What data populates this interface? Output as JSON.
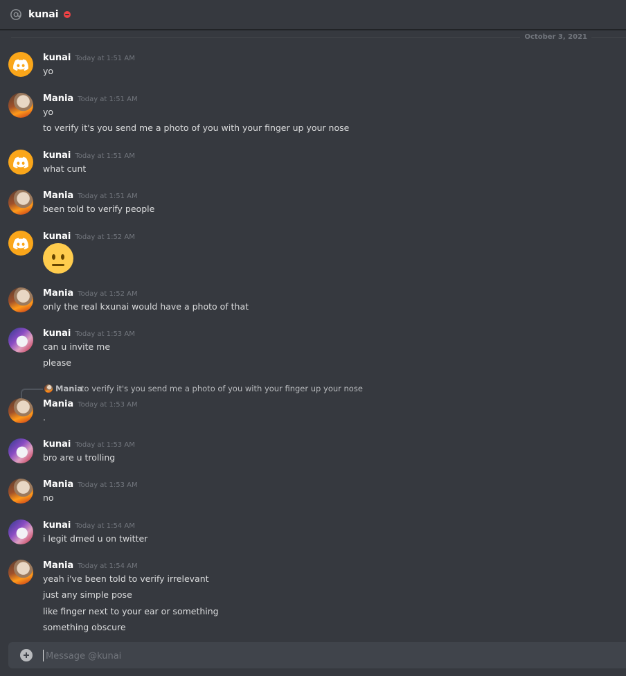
{
  "header": {
    "channel_name": "kunai",
    "status": "do-not-disturb",
    "status_color": "#ed4245",
    "icon": "at-icon"
  },
  "divider": {
    "date": "October 3, 2021"
  },
  "messages": [
    {
      "author": "kunai",
      "timestamp": "Today at 1:51 AM",
      "avatar": "discord-default-icon",
      "lines": [
        "yo"
      ]
    },
    {
      "author": "Mania",
      "timestamp": "Today at 1:51 AM",
      "avatar": "anime-avatar",
      "lines": [
        "yo",
        "to verify it's you send me a photo of you with your finger up your nose"
      ]
    },
    {
      "author": "kunai",
      "timestamp": "Today at 1:51 AM",
      "avatar": "discord-default-icon",
      "lines": [
        "what cunt"
      ]
    },
    {
      "author": "Mania",
      "timestamp": "Today at 1:51 AM",
      "avatar": "anime-avatar",
      "lines": [
        "been told to verify people"
      ]
    },
    {
      "author": "kunai",
      "timestamp": "Today at 1:52 AM",
      "avatar": "discord-default-icon",
      "emoji": "neutral-face-emoji"
    },
    {
      "author": "Mania",
      "timestamp": "Today at 1:52 AM",
      "avatar": "anime-avatar",
      "lines": [
        "only the real kxunai would have a photo of that"
      ]
    },
    {
      "author": "kunai",
      "timestamp": "Today at 1:53 AM",
      "avatar": "profile-avatar",
      "lines": [
        "can u invite me",
        "please"
      ]
    },
    {
      "author": "Mania",
      "timestamp": "Today at 1:53 AM",
      "avatar": "anime-avatar",
      "lines": [
        "."
      ],
      "reply": {
        "author": "Mania",
        "text": "to verify it's you send me a photo of you with your finger up your nose"
      }
    },
    {
      "author": "kunai",
      "timestamp": "Today at 1:53 AM",
      "avatar": "profile-avatar",
      "lines": [
        "bro are u trolling"
      ]
    },
    {
      "author": "Mania",
      "timestamp": "Today at 1:53 AM",
      "avatar": "anime-avatar",
      "lines": [
        "no"
      ]
    },
    {
      "author": "kunai",
      "timestamp": "Today at 1:54 AM",
      "avatar": "profile-avatar",
      "lines": [
        "i legit dmed u on twitter"
      ]
    },
    {
      "author": "Mania",
      "timestamp": "Today at 1:54 AM",
      "avatar": "anime-avatar",
      "lines": [
        "yeah i've been told to verify irrelevant",
        "just any simple pose",
        "like finger next to your ear or something",
        "something obscure"
      ]
    }
  ],
  "composer": {
    "placeholder": "Message @kunai",
    "value": "",
    "attach_icon": "plus-circle-icon"
  }
}
